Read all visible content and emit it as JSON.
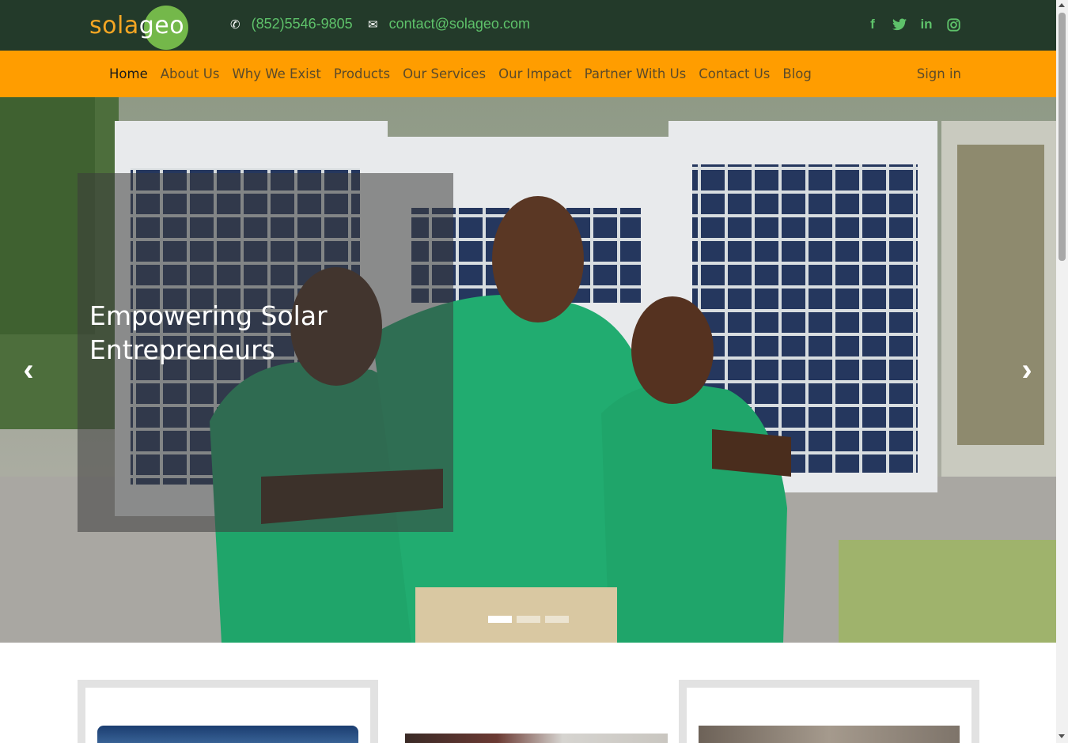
{
  "header": {
    "logo_part1": "sola",
    "logo_part2": "geo",
    "phone": "(852)5546-9805",
    "email": "contact@solageo.com",
    "phone_icon": "phone-icon",
    "email_icon": "envelope-icon",
    "socials": [
      "facebook-icon",
      "twitter-icon",
      "linkedin-icon",
      "instagram-icon"
    ]
  },
  "nav": {
    "items": [
      {
        "label": "Home"
      },
      {
        "label": "About Us"
      },
      {
        "label": "Why We Exist"
      },
      {
        "label": "Products"
      },
      {
        "label": "Our Services"
      },
      {
        "label": "Our Impact"
      },
      {
        "label": "Partner With Us"
      },
      {
        "label": "Contact Us"
      },
      {
        "label": "Blog"
      }
    ],
    "active": "Home",
    "signin": "Sign in"
  },
  "hero": {
    "caption": "Empowering Solar Entrepreneurs",
    "prev_icon": "chevron-left-icon",
    "next_icon": "chevron-right-icon",
    "slide_count": 3,
    "active_slide": 1
  },
  "colors": {
    "topbar": "#233a2a",
    "accent_green": "#5ec26a",
    "nav_orange": "#ff9d00",
    "logo_orange": "#f5a623",
    "logo_green": "#74b84a"
  }
}
